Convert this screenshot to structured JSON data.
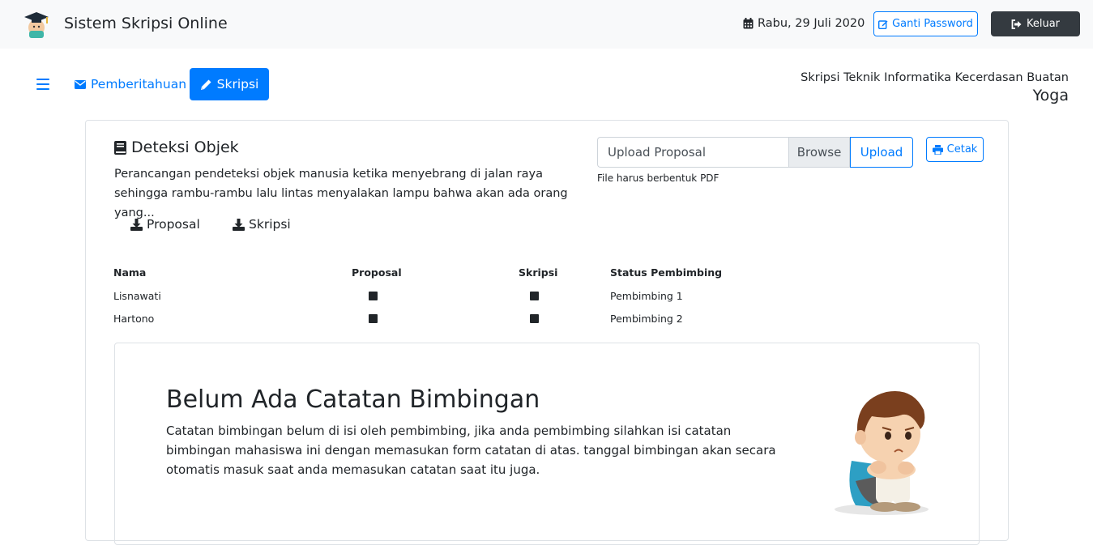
{
  "navbar": {
    "brand": "Sistem Skripsi Online",
    "date": "Rabu, 29 Juli 2020",
    "ganti_password": "Ganti Password",
    "keluar": "Keluar"
  },
  "subnav": {
    "pemberitahuan": "Pemberitahuan",
    "skripsi": "Skripsi"
  },
  "header": {
    "subtitle": "Skripsi Teknik Informatika Kecerdasan Buatan",
    "name": "Yoga"
  },
  "thesis": {
    "title": "Deteksi Objek",
    "description": "Perancangan pendeteksi objek manusia ketika menyebrang di jalan raya sehingga rambu-rambu lalu lintas menyalakan lampu bahwa akan ada orang yang...",
    "download_proposal": "Proposal",
    "download_skripsi": "Skripsi"
  },
  "upload": {
    "placeholder": "Upload Proposal",
    "browse": "Browse",
    "button": "Upload",
    "help": "File harus berbentuk PDF",
    "cetak": "Cetak"
  },
  "table": {
    "headers": [
      "Nama",
      "Proposal",
      "Skripsi",
      "Status Pembimbing"
    ],
    "rows": [
      {
        "nama": "Lisnawati",
        "status": "Pembimbing 1"
      },
      {
        "nama": "Hartono",
        "status": "Pembimbing 2"
      }
    ]
  },
  "notes": {
    "title": "Belum Ada Catatan Bimbingan",
    "text": "Catatan bimbingan belum di isi oleh pembimbing, jika anda pembimbing silahkan isi catatan bimbingan mahasiswa ini dengan memasukan form catatan di atas. tanggal bimbingan akan secara otomatis masuk saat anda memasukan catatan saat itu juga."
  },
  "colors": {
    "primary": "#007bff",
    "dark": "#343a40",
    "light": "#f8f9fa"
  },
  "icons": [
    "graduation-logo-icon",
    "calendar-icon",
    "edit-icon",
    "sign-out-icon",
    "bars-icon",
    "envelope-icon",
    "pencil-icon",
    "book-icon",
    "download-icon",
    "print-icon",
    "sad-boy-illustration"
  ]
}
